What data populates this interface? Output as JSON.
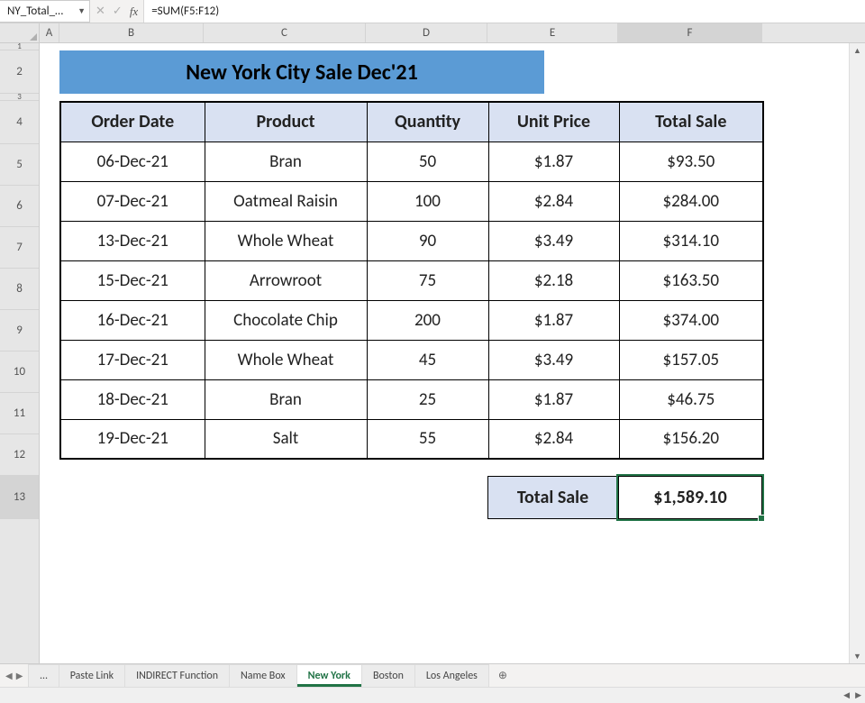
{
  "namebox": "NY_Total_…",
  "formula": "=SUM(F5:F12)",
  "columns": {
    "A": "A",
    "B": "B",
    "C": "C",
    "D": "D",
    "E": "E",
    "F": "F"
  },
  "rowlabels": [
    "1",
    "2",
    "3",
    "4",
    "5",
    "6",
    "7",
    "8",
    "9",
    "10",
    "11",
    "12",
    "13"
  ],
  "title": "New York City Sale Dec'21",
  "headers": {
    "orderdate": "Order Date",
    "product": "Product",
    "quantity": "Quantity",
    "unitprice": "Unit Price",
    "totalsale": "Total Sale"
  },
  "rows": [
    {
      "date": "06-Dec-21",
      "product": "Bran",
      "qty": "50",
      "price": "$1.87",
      "total": "$93.50"
    },
    {
      "date": "07-Dec-21",
      "product": "Oatmeal Raisin",
      "qty": "100",
      "price": "$2.84",
      "total": "$284.00"
    },
    {
      "date": "13-Dec-21",
      "product": "Whole Wheat",
      "qty": "90",
      "price": "$3.49",
      "total": "$314.10"
    },
    {
      "date": "15-Dec-21",
      "product": "Arrowroot",
      "qty": "75",
      "price": "$2.18",
      "total": "$163.50"
    },
    {
      "date": "16-Dec-21",
      "product": "Chocolate Chip",
      "qty": "200",
      "price": "$1.87",
      "total": "$374.00"
    },
    {
      "date": "17-Dec-21",
      "product": "Whole Wheat",
      "qty": "45",
      "price": "$3.49",
      "total": "$157.05"
    },
    {
      "date": "18-Dec-21",
      "product": "Bran",
      "qty": "25",
      "price": "$1.87",
      "total": "$46.75"
    },
    {
      "date": "19-Dec-21",
      "product": "Salt",
      "qty": "55",
      "price": "$2.84",
      "total": "$156.20"
    }
  ],
  "totals": {
    "label": "Total Sale",
    "value": "$1,589.10"
  },
  "tabs": {
    "ellipsis": "…",
    "pastelink": "Paste Link",
    "indirect": "INDIRECT Function",
    "namebox": "Name Box",
    "ny": "New York",
    "boston": "Boston",
    "la": "Los Angeles",
    "add": "⊕"
  },
  "chart_data": {
    "type": "table",
    "title": "New York City Sale Dec'21",
    "columns": [
      "Order Date",
      "Product",
      "Quantity",
      "Unit Price",
      "Total Sale"
    ],
    "rows": [
      [
        "06-Dec-21",
        "Bran",
        50,
        1.87,
        93.5
      ],
      [
        "07-Dec-21",
        "Oatmeal Raisin",
        100,
        2.84,
        284.0
      ],
      [
        "13-Dec-21",
        "Whole Wheat",
        90,
        3.49,
        314.1
      ],
      [
        "15-Dec-21",
        "Arrowroot",
        75,
        2.18,
        163.5
      ],
      [
        "16-Dec-21",
        "Chocolate Chip",
        200,
        1.87,
        374.0
      ],
      [
        "17-Dec-21",
        "Whole Wheat",
        45,
        3.49,
        157.05
      ],
      [
        "18-Dec-21",
        "Bran",
        25,
        1.87,
        46.75
      ],
      [
        "19-Dec-21",
        "Salt",
        55,
        2.84,
        156.2
      ]
    ],
    "total_sale": 1589.1
  }
}
